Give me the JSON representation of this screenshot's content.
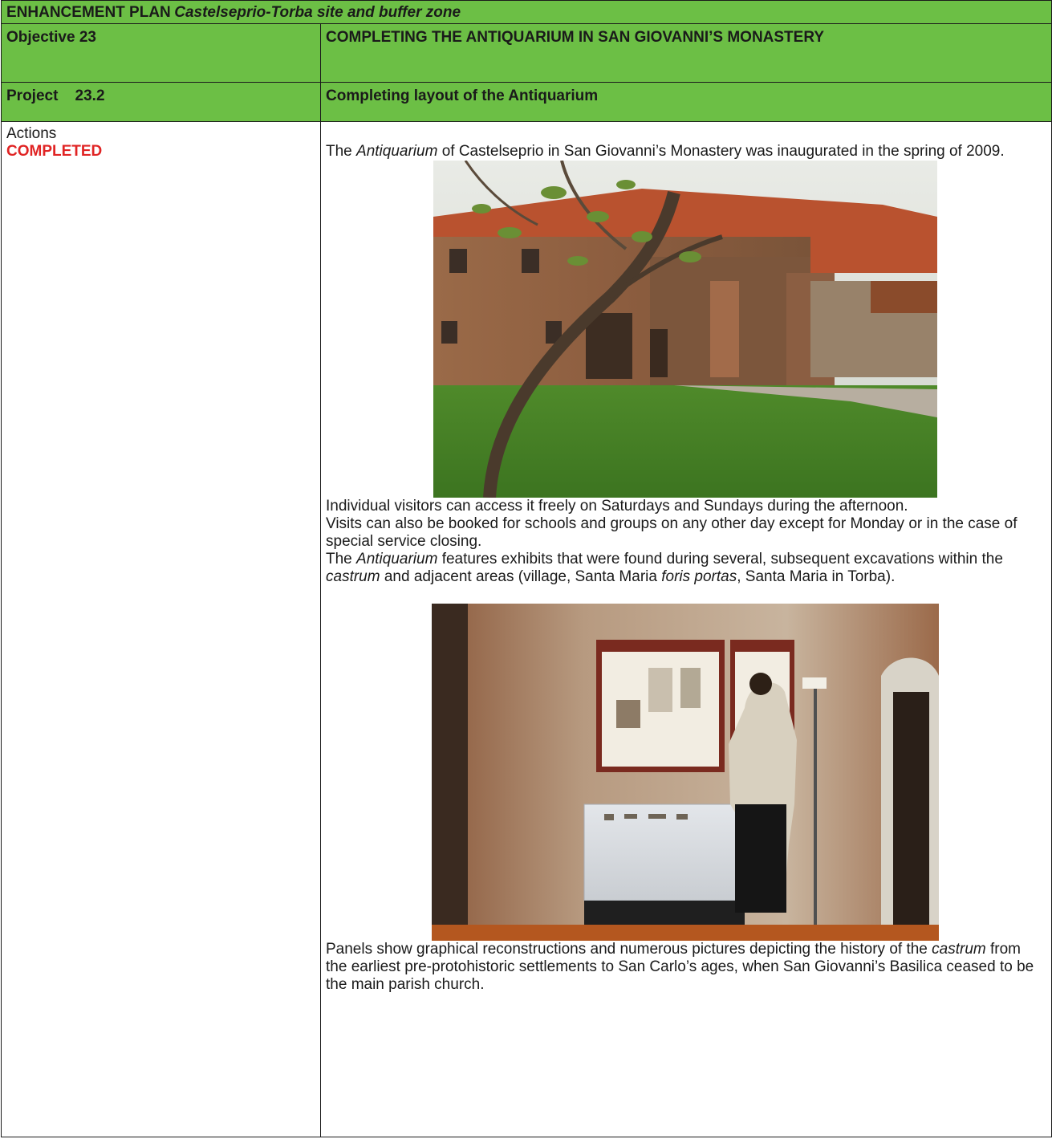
{
  "header": {
    "plan_label": "ENHANCEMENT PLAN",
    "plan_subtitle": "Castelseprio-Torba site and buffer zone"
  },
  "objective": {
    "label": "Objective 23",
    "title": "COMPLETING THE ANTIQUARIUM IN SAN GIOVANNI’S MONASTERY"
  },
  "project": {
    "label": "Project    23.2",
    "title": "Completing layout of the Antiquarium"
  },
  "actions": {
    "label": "Actions",
    "status": "COMPLETED",
    "status_color": "#e02424"
  },
  "content": {
    "p1_a": "The ",
    "p1_em": "Antiquarium",
    "p1_b": " of Castelseprio in San Giovanni’s Monastery was inaugurated in the spring of 2009.",
    "p2": "Individual visitors can access it freely on Saturdays and Sundays during the afternoon.",
    "p3": "Visits can also be booked for schools and groups on any other day except for Monday or in the case of special service closing.",
    "p4_a": "The ",
    "p4_em1": "Antiquarium",
    "p4_b": " features exhibits that were found during several, subsequent excavations within the ",
    "p4_em2": "castrum",
    "p4_c": " and adjacent areas (village, Santa Maria ",
    "p4_em3": "foris portas",
    "p4_d": ", Santa Maria in Torba).",
    "p5_a": "Panels show graphical reconstructions and numerous pictures depicting the history of the ",
    "p5_em": "castrum",
    "p5_b": " from the earliest pre-protohistoric settlements to San Carlo’s ages, when San Giovanni’s Basilica ceased to be the main parish church."
  },
  "colors": {
    "header_green": "#6cbf45",
    "border": "#1b1b1b"
  }
}
